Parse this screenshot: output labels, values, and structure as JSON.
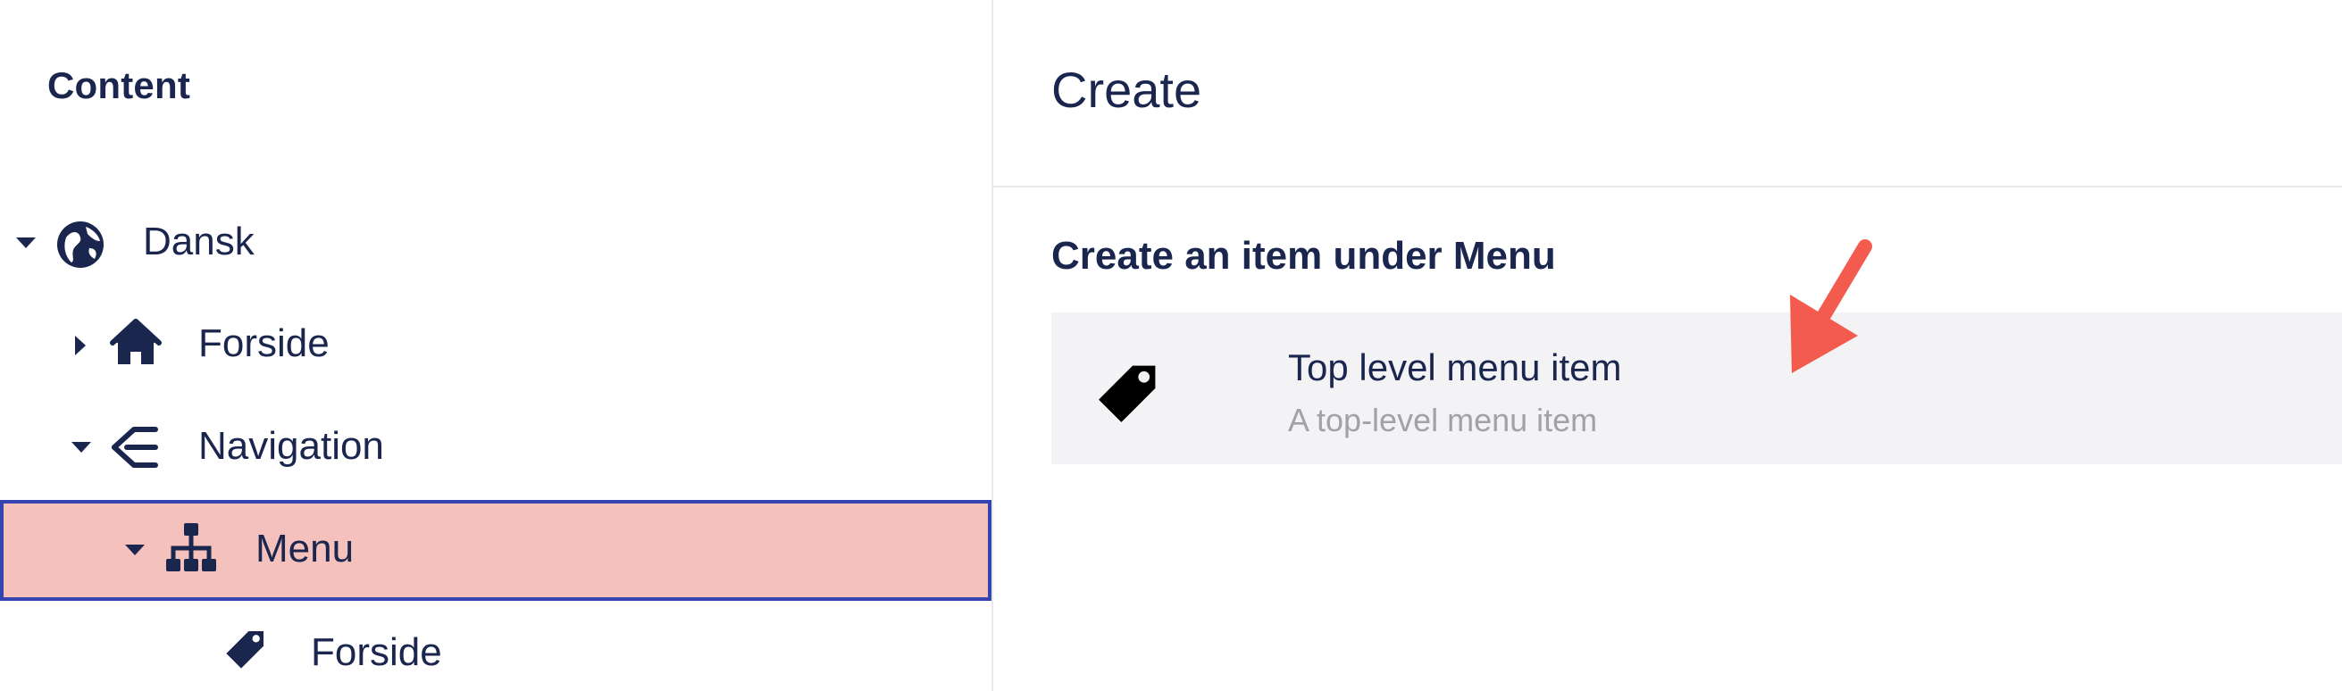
{
  "tree": {
    "title": "Content",
    "nodes": [
      {
        "label": "Dansk",
        "icon": "globe-icon",
        "expanded": true
      },
      {
        "label": "Forside",
        "icon": "home-icon",
        "expanded": false
      },
      {
        "label": "Navigation",
        "icon": "navigation-icon",
        "expanded": true
      },
      {
        "label": "Menu",
        "icon": "sitemap-icon",
        "expanded": true,
        "selected": true
      },
      {
        "label": "Forside",
        "icon": "tag-icon"
      }
    ]
  },
  "create": {
    "title": "Create",
    "subtitle": "Create an item under Menu",
    "items": [
      {
        "name": "Top level menu item",
        "description": "A top-level menu item",
        "icon": "tag-icon"
      }
    ]
  },
  "colors": {
    "text": "#1b264f",
    "selected_bg": "#f4c1bc",
    "selected_border": "#3544b1",
    "item_bg": "#f3f3f5",
    "muted_text": "#a2a1a6",
    "annotation_arrow": "#f35b4e"
  }
}
